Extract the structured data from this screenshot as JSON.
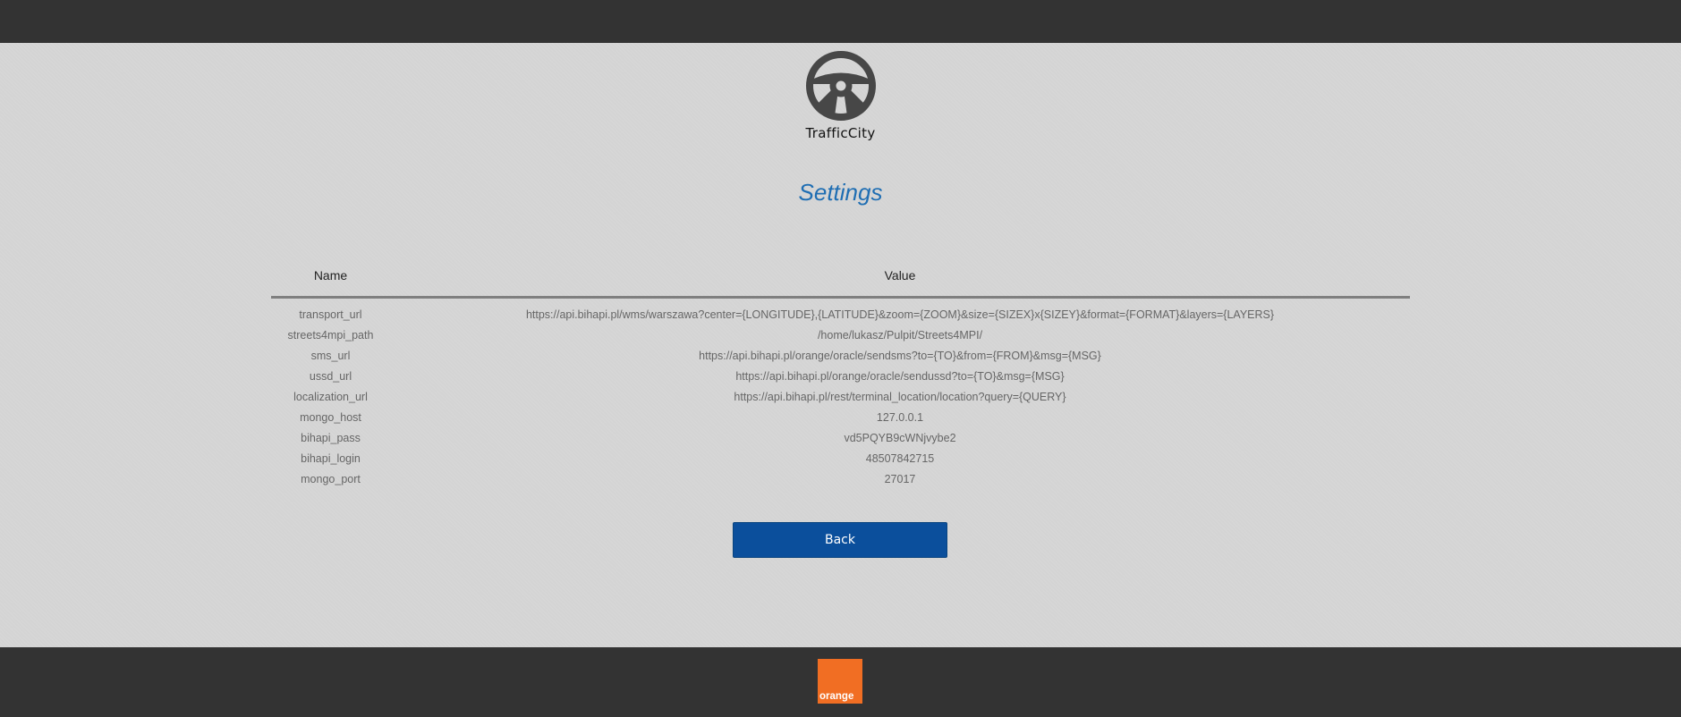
{
  "app": {
    "name": "TrafficCity",
    "logo_icon": "steering-wheel-icon"
  },
  "page": {
    "title": "Settings"
  },
  "table": {
    "headers": {
      "name": "Name",
      "value": "Value"
    },
    "rows": [
      {
        "name": "transport_url",
        "value": "https://api.bihapi.pl/wms/warszawa?center={LONGITUDE},{LATITUDE}&zoom={ZOOM}&size={SIZEX}x{SIZEY}&format={FORMAT}&layers={LAYERS}"
      },
      {
        "name": "streets4mpi_path",
        "value": "/home/lukasz/Pulpit/Streets4MPI/"
      },
      {
        "name": "sms_url",
        "value": "https://api.bihapi.pl/orange/oracle/sendsms?to={TO}&from={FROM}&msg={MSG}"
      },
      {
        "name": "ussd_url",
        "value": "https://api.bihapi.pl/orange/oracle/sendussd?to={TO}&msg={MSG}"
      },
      {
        "name": "localization_url",
        "value": "https://api.bihapi.pl/rest/terminal_location/location?query={QUERY}"
      },
      {
        "name": "mongo_host",
        "value": "127.0.0.1"
      },
      {
        "name": "bihapi_pass",
        "value": "vd5PQYB9cWNjvybe2"
      },
      {
        "name": "bihapi_login",
        "value": "48507842715"
      },
      {
        "name": "mongo_port",
        "value": "27017"
      }
    ]
  },
  "actions": {
    "back_label": "Back"
  },
  "footer": {
    "brand_text": "orange"
  },
  "colors": {
    "header_bar": "#333333",
    "title": "#1f6eb3",
    "button": "#0b4f9c",
    "brand_orange": "#f16e23"
  }
}
